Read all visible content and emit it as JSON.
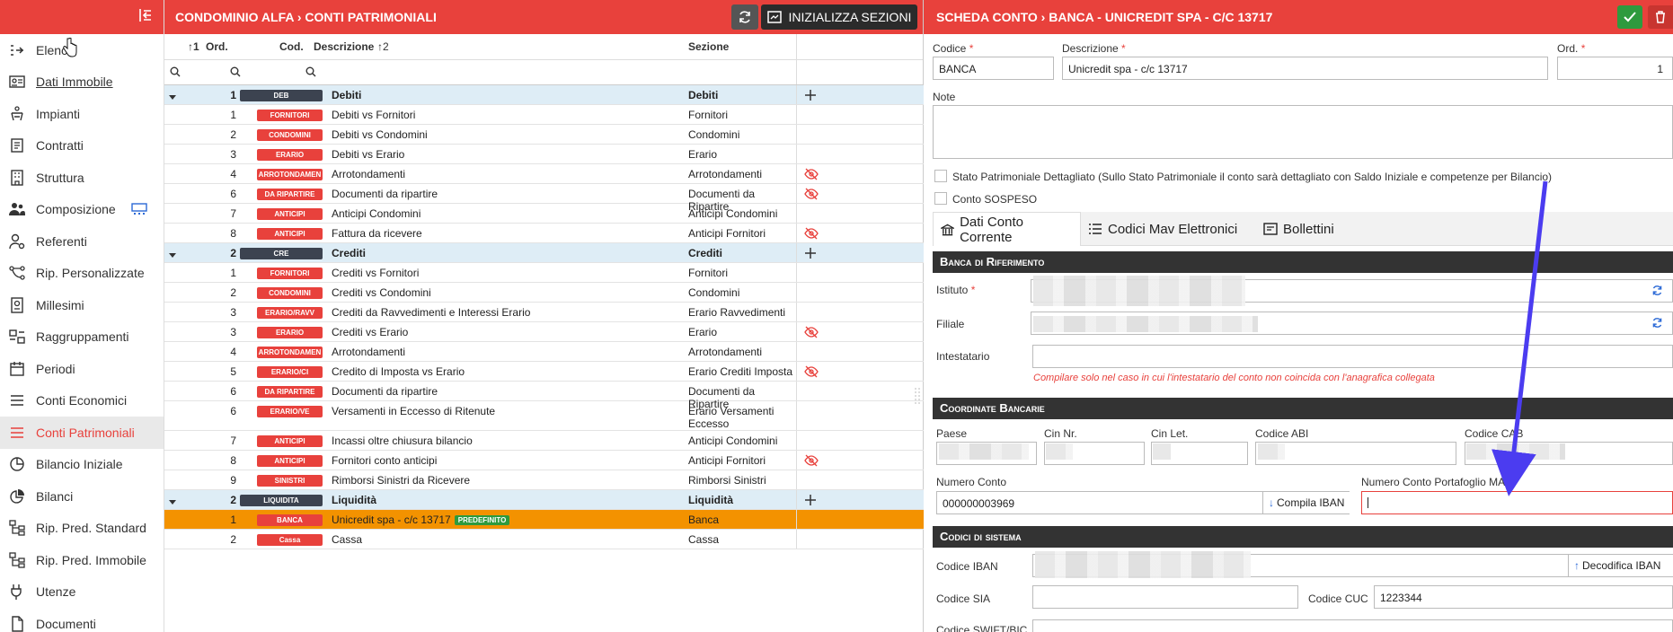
{
  "sidebar": {
    "items": [
      {
        "label": "Elenco",
        "icon": "list-login-icon",
        "underline": false,
        "active": false
      },
      {
        "label": "Dati Immobile",
        "icon": "id-card-icon",
        "underline": true,
        "active": false
      },
      {
        "label": "Impianti",
        "icon": "elevator-icon",
        "underline": false,
        "active": false
      },
      {
        "label": "Contratti",
        "icon": "handshake-icon",
        "underline": false,
        "active": false
      },
      {
        "label": "Struttura",
        "icon": "building-icon",
        "underline": false,
        "active": false
      },
      {
        "label": "Composizione",
        "icon": "users-icon",
        "underline": false,
        "active": false
      },
      {
        "label": "Referenti",
        "icon": "user-gear-icon",
        "underline": false,
        "active": false
      },
      {
        "label": "Rip. Personalizzate",
        "icon": "branch-icon",
        "underline": false,
        "active": false
      },
      {
        "label": "Millesimi",
        "icon": "receipt-icon",
        "underline": false,
        "active": false
      },
      {
        "label": "Raggruppamenti",
        "icon": "group-icon",
        "underline": false,
        "active": false
      },
      {
        "label": "Periodi",
        "icon": "calendar-icon",
        "underline": false,
        "active": false
      },
      {
        "label": "Conti Economici",
        "icon": "lines-icon",
        "underline": false,
        "active": false
      },
      {
        "label": "Conti Patrimoniali",
        "icon": "lines-icon",
        "underline": false,
        "active": true
      },
      {
        "label": "Bilancio Iniziale",
        "icon": "pie-icon",
        "underline": false,
        "active": false
      },
      {
        "label": "Bilanci",
        "icon": "chart-pie-icon",
        "underline": false,
        "active": false
      },
      {
        "label": "Rip. Pred. Standard",
        "icon": "tree-icon",
        "underline": false,
        "active": false
      },
      {
        "label": "Rip. Pred. Immobile",
        "icon": "tree-icon",
        "underline": false,
        "active": false
      },
      {
        "label": "Utenze",
        "icon": "plug-icon",
        "underline": false,
        "active": false
      },
      {
        "label": "Documenti",
        "icon": "file-icon",
        "underline": false,
        "active": false
      }
    ]
  },
  "mid": {
    "title": "CONDOMINIO ALFA › CONTI PATRIMONIALI",
    "init_label": "INIZIALIZZA SEZIONI",
    "columns": {
      "ord": "Ord.",
      "ord_sort": "↑1",
      "cod": "Cod.",
      "descr": "Descrizione",
      "descr_sort": "↑2",
      "sez": "Sezione"
    },
    "rows": [
      {
        "type": "group",
        "ord": "1",
        "code": "DEB",
        "desc": "Debiti",
        "sez": "Debiti",
        "hidden": false
      },
      {
        "type": "item",
        "ord": "1",
        "code": "FORNITORI",
        "desc": "Debiti vs Fornitori",
        "sez": "Fornitori",
        "hidden": false
      },
      {
        "type": "item",
        "ord": "2",
        "code": "CONDOMINI",
        "desc": "Debiti vs Condomini",
        "sez": "Condomini",
        "hidden": false
      },
      {
        "type": "item",
        "ord": "3",
        "code": "ERARIO",
        "desc": "Debiti vs Erario",
        "sez": "Erario",
        "hidden": false
      },
      {
        "type": "item",
        "ord": "4",
        "code": "ARROTONDAMEN",
        "desc": "Arrotondamenti",
        "sez": "Arrotondamenti",
        "hidden": true
      },
      {
        "type": "item",
        "ord": "6",
        "code": "DA RIPARTIRE",
        "desc": "Documenti da ripartire",
        "sez": "Documenti da Ripartire",
        "hidden": true
      },
      {
        "type": "item",
        "ord": "7",
        "code": "ANTICIPI",
        "desc": "Anticipi Condomini",
        "sez": "Anticipi Condomini",
        "hidden": false
      },
      {
        "type": "item",
        "ord": "8",
        "code": "ANTICIPI",
        "desc": "Fattura da ricevere",
        "sez": "Anticipi Fornitori",
        "hidden": true
      },
      {
        "type": "group",
        "ord": "2",
        "code": "CRE",
        "desc": "Crediti",
        "sez": "Crediti",
        "hidden": false
      },
      {
        "type": "item",
        "ord": "1",
        "code": "FORNITORI",
        "desc": "Crediti vs Fornitori",
        "sez": "Fornitori",
        "hidden": false
      },
      {
        "type": "item",
        "ord": "2",
        "code": "CONDOMINI",
        "desc": "Crediti vs Condomini",
        "sez": "Condomini",
        "hidden": false
      },
      {
        "type": "item",
        "ord": "3",
        "code": "ERARIO/RAVV",
        "desc": "Crediti da Ravvedimenti e Interessi Erario",
        "sez": "Erario Ravvedimenti",
        "hidden": false
      },
      {
        "type": "item",
        "ord": "3",
        "code": "ERARIO",
        "desc": "Crediti vs Erario",
        "sez": "Erario",
        "hidden": true
      },
      {
        "type": "item",
        "ord": "4",
        "code": "ARROTONDAMEN",
        "desc": "Arrotondamenti",
        "sez": "Arrotondamenti",
        "hidden": false
      },
      {
        "type": "item",
        "ord": "5",
        "code": "ERARIO/CI",
        "desc": "Credito di Imposta vs Erario",
        "sez": "Erario Crediti Imposta",
        "hidden": true
      },
      {
        "type": "item",
        "ord": "6",
        "code": "DA RIPARTIRE",
        "desc": "Documenti da ripartire",
        "sez": "Documenti da Ripartire",
        "hidden": false
      },
      {
        "type": "item",
        "ord": "6",
        "code": "ERARIO/VE",
        "desc": "Versamenti in Eccesso di Ritenute",
        "sez": "Erario Versamenti Eccesso",
        "hidden": false,
        "tall": true
      },
      {
        "type": "item",
        "ord": "7",
        "code": "ANTICIPI",
        "desc": "Incassi oltre chiusura bilancio",
        "sez": "Anticipi Condomini",
        "hidden": false
      },
      {
        "type": "item",
        "ord": "8",
        "code": "ANTICIPI",
        "desc": "Fornitori conto anticipi",
        "sez": "Anticipi Fornitori",
        "hidden": true
      },
      {
        "type": "item",
        "ord": "9",
        "code": "SINISTRI",
        "desc": "Rimborsi Sinistri da Ricevere",
        "sez": "Rimborsi Sinistri",
        "hidden": false
      },
      {
        "type": "group",
        "ord": "2",
        "code": "LIQUIDITA",
        "desc": "Liquidità",
        "sez": "Liquidità",
        "hidden": false
      },
      {
        "type": "selected",
        "ord": "1",
        "code": "BANCA",
        "desc": "Unicredit spa - c/c 13717",
        "sez": "Banca",
        "hidden": false,
        "badge": "PREDEFINITO"
      },
      {
        "type": "item",
        "ord": "2",
        "code": "Cassa",
        "desc": "Cassa",
        "sez": "Cassa",
        "hidden": false
      }
    ]
  },
  "right": {
    "title": "SCHEDA CONTO › BANCA - UNICREDIT SPA - C/C 13717",
    "codice_label": "Codice",
    "codice_value": "BANCA",
    "descr_label": "Descrizione",
    "descr_value": "Unicredit spa - c/c 13717",
    "ord_label": "Ord.",
    "ord_value": "1",
    "note_label": "Note",
    "chk1_label": "Stato Patrimoniale Dettagliato (Sullo Stato Patrimoniale il conto sarà dettagliato con Saldo Iniziale e competenze per Bilancio)",
    "chk2_label": "Conto SOSPESO",
    "tabs": [
      "Dati Conto Corrente",
      "Codici Mav Elettronici",
      "Bollettini"
    ],
    "sect_banca": "Banca di Riferimento",
    "istituto_label": "Istituto",
    "filiale_label": "Filiale",
    "intestatario_label": "Intestatario",
    "intestatario_hint": "Compilare solo nel caso in cui l'intestatario del conto non coincida con l'anagrafica collegata",
    "sect_coord": "Coordinate Bancarie",
    "paese_label": "Paese",
    "cin_label": "Cin Nr.",
    "cinlet_label": "Cin Let.",
    "abi_label": "Codice ABI",
    "cab_label": "Codice CAB",
    "numconto_label": "Numero Conto",
    "numconto_value": "000000003969",
    "compila_label": "Compila IBAN",
    "mav_label": "Numero Conto Portafoglio MAV",
    "sect_sistema": "Codici di sistema",
    "iban_label": "Codice IBAN",
    "decodifica_label": "Decodifica IBAN",
    "sia_label": "Codice SIA",
    "cuc_label": "Codice CUC",
    "cuc_value": "1223344",
    "swift_label": "Codice SWIFT/BIC"
  },
  "colors": {
    "brand": "#e8413c",
    "selected_row": "#f39200",
    "group_row": "#deedf6",
    "arrow": "#4b3cf0"
  }
}
